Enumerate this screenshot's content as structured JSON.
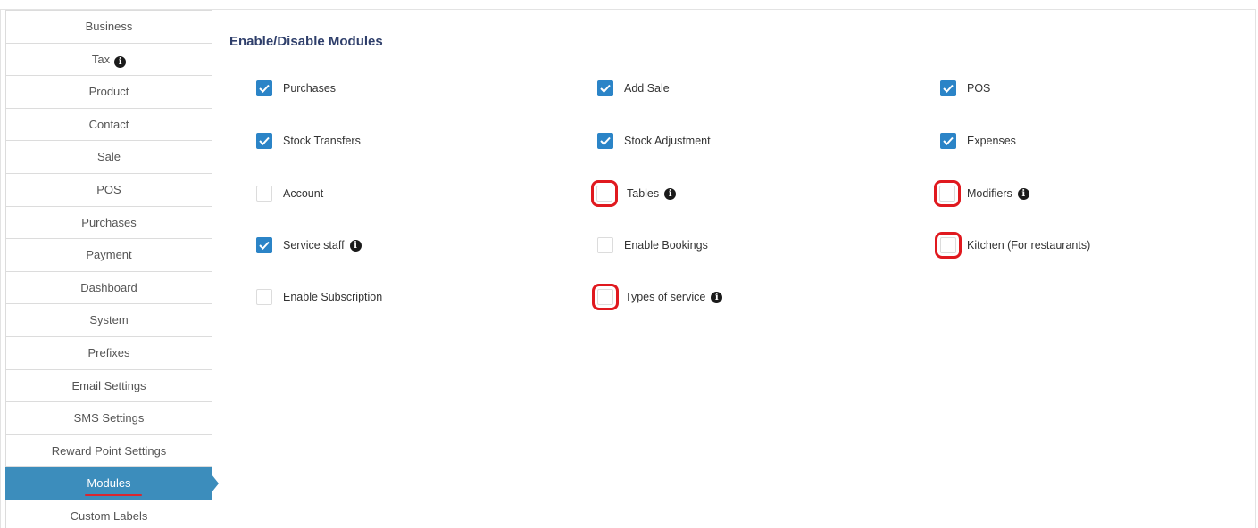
{
  "sidebar": {
    "items": [
      {
        "label": "Business"
      },
      {
        "label": "Tax",
        "info": true
      },
      {
        "label": "Product"
      },
      {
        "label": "Contact"
      },
      {
        "label": "Sale"
      },
      {
        "label": "POS"
      },
      {
        "label": "Purchases"
      },
      {
        "label": "Payment"
      },
      {
        "label": "Dashboard"
      },
      {
        "label": "System"
      },
      {
        "label": "Prefixes"
      },
      {
        "label": "Email Settings"
      },
      {
        "label": "SMS Settings"
      },
      {
        "label": "Reward Point Settings"
      },
      {
        "label": "Modules",
        "active": true
      },
      {
        "label": "Custom Labels"
      }
    ],
    "active_item": "Modules"
  },
  "main": {
    "title": "Enable/Disable Modules",
    "modules": [
      {
        "label": "Purchases",
        "checked": true
      },
      {
        "label": "Add Sale",
        "checked": true
      },
      {
        "label": "POS",
        "checked": true
      },
      {
        "label": "Stock Transfers",
        "checked": true
      },
      {
        "label": "Stock Adjustment",
        "checked": true
      },
      {
        "label": "Expenses",
        "checked": true
      },
      {
        "label": "Account",
        "checked": false
      },
      {
        "label": "Tables",
        "checked": false,
        "info": true,
        "highlighted": true
      },
      {
        "label": "Modifiers",
        "checked": false,
        "info": true,
        "highlighted": true
      },
      {
        "label": "Service staff",
        "checked": true,
        "info": true
      },
      {
        "label": "Enable Bookings",
        "checked": false
      },
      {
        "label": "Kitchen (For restaurants)",
        "checked": false,
        "highlighted": true
      },
      {
        "label": "Enable Subscription",
        "checked": false
      },
      {
        "label": "Types of service",
        "checked": false,
        "info": true,
        "highlighted": true
      }
    ]
  },
  "icons": {
    "info": "info-circle-icon",
    "check": "checkmark-icon"
  },
  "colors": {
    "accent": "#3c8dbc",
    "checkbox_checked": "#2b84c7",
    "highlight": "#e0191f",
    "title": "#2f3f6b"
  }
}
